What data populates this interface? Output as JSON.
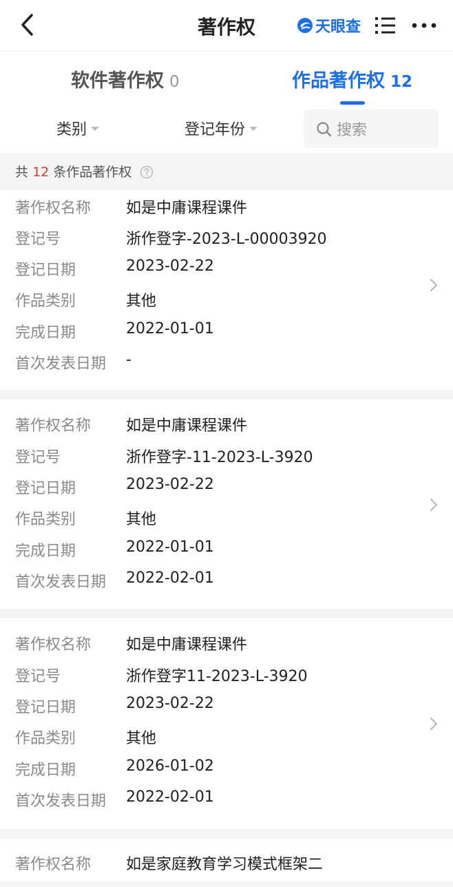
{
  "header": {
    "title": "著作权",
    "brand_text": "天眼查"
  },
  "tabs": [
    {
      "label": "软件著作权",
      "count": "0"
    },
    {
      "label": "作品著作权",
      "count": "12"
    }
  ],
  "filters": {
    "category": "类别",
    "year": "登记年份",
    "search_placeholder": "搜索"
  },
  "summary": {
    "prefix": "共",
    "count": "12",
    "suffix": "条作品著作权"
  },
  "labels": {
    "name": "著作权名称",
    "reg_no": "登记号",
    "reg_date": "登记日期",
    "category": "作品类别",
    "done_date": "完成日期",
    "publish_date": "首次发表日期"
  },
  "records": [
    {
      "name": "如是中庸课程课件",
      "reg_no": "浙作登字-2023-L-00003920",
      "reg_date": "2023-02-22",
      "category": "其他",
      "done_date": "2022-01-01",
      "publish_date": "-"
    },
    {
      "name": "如是中庸课程课件",
      "reg_no": "浙作登字-11-2023-L-3920",
      "reg_date": "2023-02-22",
      "category": "其他",
      "done_date": "2022-01-01",
      "publish_date": "2022-02-01"
    },
    {
      "name": "如是中庸课程课件",
      "reg_no": "浙作登字11-2023-L-3920",
      "reg_date": "2023-02-22",
      "category": "其他",
      "done_date": "2026-01-02",
      "publish_date": "2022-02-01"
    },
    {
      "name": "如是家庭教育学习模式框架二"
    }
  ],
  "colors": {
    "accent": "#1c6fe5",
    "highlight": "#e0382d"
  }
}
